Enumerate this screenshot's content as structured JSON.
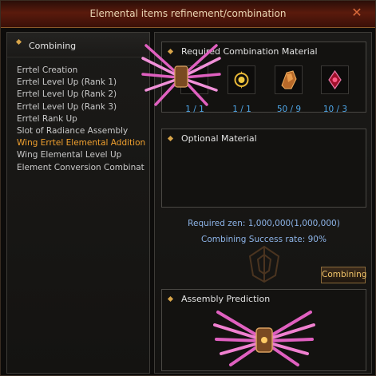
{
  "window": {
    "title": "Elemental items refinement/combination",
    "close_icon": "close-icon"
  },
  "sidebar": {
    "header": "Combining",
    "items": [
      {
        "label": "Errtel Creation",
        "active": false
      },
      {
        "label": "Errtel Level Up (Rank 1)",
        "active": false
      },
      {
        "label": "Errtel Level Up (Rank 2)",
        "active": false
      },
      {
        "label": "Errtel Level Up (Rank 3)",
        "active": false
      },
      {
        "label": "Errtel Rank Up",
        "active": false
      },
      {
        "label": "Slot of Radiance Assembly",
        "active": false
      },
      {
        "label": "Wing Errtel Elemental Addition",
        "active": true
      },
      {
        "label": "Wing Elemental Level Up",
        "active": false
      },
      {
        "label": "Element Conversion Combinat",
        "active": false
      }
    ]
  },
  "required_materials": {
    "title": "Required Combination Material",
    "slots": [
      {
        "icon": "wings-icon",
        "count": "1 / 1"
      },
      {
        "icon": "gold-emblem-icon",
        "count": "1 / 1"
      },
      {
        "icon": "crystal-shard-icon",
        "count": "50 / 9"
      },
      {
        "icon": "red-gem-icon",
        "count": "10 / 3"
      }
    ]
  },
  "optional_material": {
    "title": "Optional Material"
  },
  "required_zen": "Required zen: 1,000,000(1,000,000)",
  "success_rate": "Combining Success rate: 90%",
  "combine_button": "Combining",
  "assembly_prediction": {
    "title": "Assembly Prediction",
    "icon": "wings-icon"
  },
  "colors": {
    "accent_orange": "#f0a02e",
    "count_blue": "#4ea6e8",
    "info_blue": "#8db4e8",
    "title_bar": "#5a1a0c"
  }
}
